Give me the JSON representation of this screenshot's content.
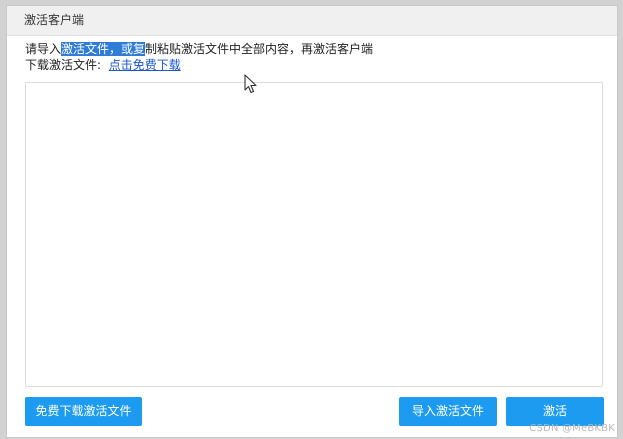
{
  "dialog": {
    "title": "激活客户端"
  },
  "instructions": {
    "line1_prefix": "请导入",
    "line1_selected": "激活文件，或复",
    "line1_suffix": "制粘贴激活文件中全部内容，再激活客户端",
    "line2_prefix": "下载激活文件:  ",
    "download_link": "点击免费下载"
  },
  "textarea": {
    "value": "",
    "placeholder": ""
  },
  "buttons": {
    "free_download": "免费下载激活文件",
    "import_file": "导入激活文件",
    "activate": "激活"
  },
  "colors": {
    "button_primary": "#1d9bf0",
    "link": "#1a56cc",
    "selection": "#2f7bd8"
  },
  "watermark": "CSDN @MeBKBK"
}
